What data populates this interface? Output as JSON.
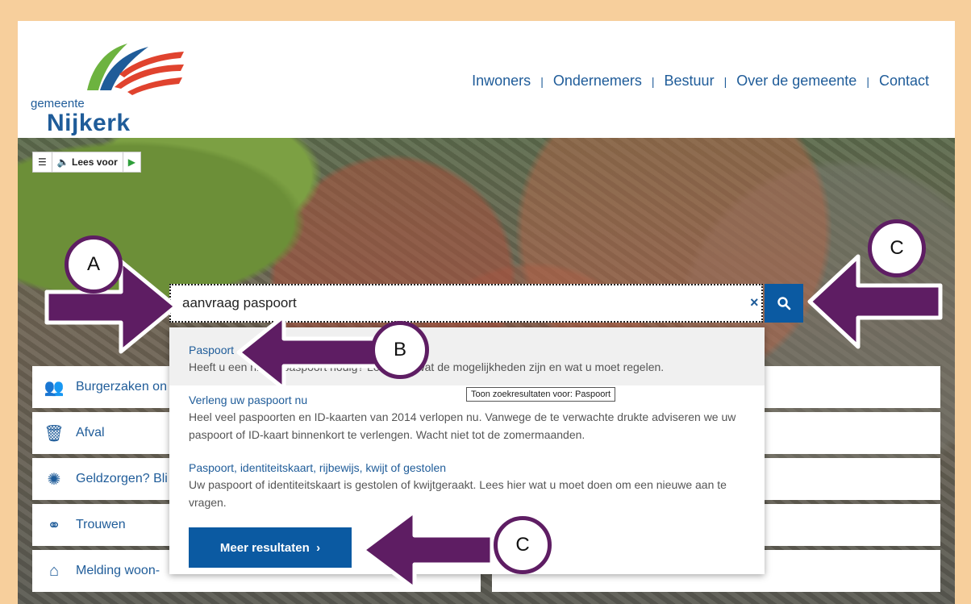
{
  "logo": {
    "small": "gemeente",
    "big": "Nijkerk"
  },
  "nav": [
    "Inwoners",
    "Ondernemers",
    "Bestuur",
    "Over de gemeente",
    "Contact"
  ],
  "toolbar": {
    "read_label": "Lees voor"
  },
  "tiles_left": [
    "Burgerzaken on",
    "Afval",
    "Geldzorgen? Bli",
    "Trouwen",
    "Melding woon-"
  ],
  "search": {
    "value": "aanvraag paspoort",
    "clear": "×"
  },
  "results": [
    {
      "title": "Paspoort",
      "desc": "Heeft u een nieuw paspoort nodig? Lees hier wat de mogelijkheden zijn en wat u moet regelen."
    },
    {
      "title": "Verleng uw paspoort nu",
      "desc": "Heel veel paspoorten en ID-kaarten van 2014 verlopen nu. Vanwege de te verwachte drukte adviseren we uw paspoort of ID-kaart binnenkort te verlengen. Wacht niet tot de zomermaanden."
    },
    {
      "title": "Paspoort, identiteitskaart, rijbewijs, kwijt of gestolen",
      "desc": "Uw paspoort of identiteitskaart is gestolen of kwijtgeraakt. Lees hier wat u moet doen om een nieuwe aan te vragen."
    }
  ],
  "tooltip": "Toon zoekresultaten voor: Paspoort",
  "more_button": "Meer resultaten",
  "callouts": {
    "a": "A",
    "b": "B",
    "c1": "C",
    "c2": "C"
  },
  "colors": {
    "brand_blue": "#0b5aa2",
    "link_blue": "#1f5c99",
    "annotation_purple": "#5e1d63",
    "frame": "#f7cf9c"
  }
}
